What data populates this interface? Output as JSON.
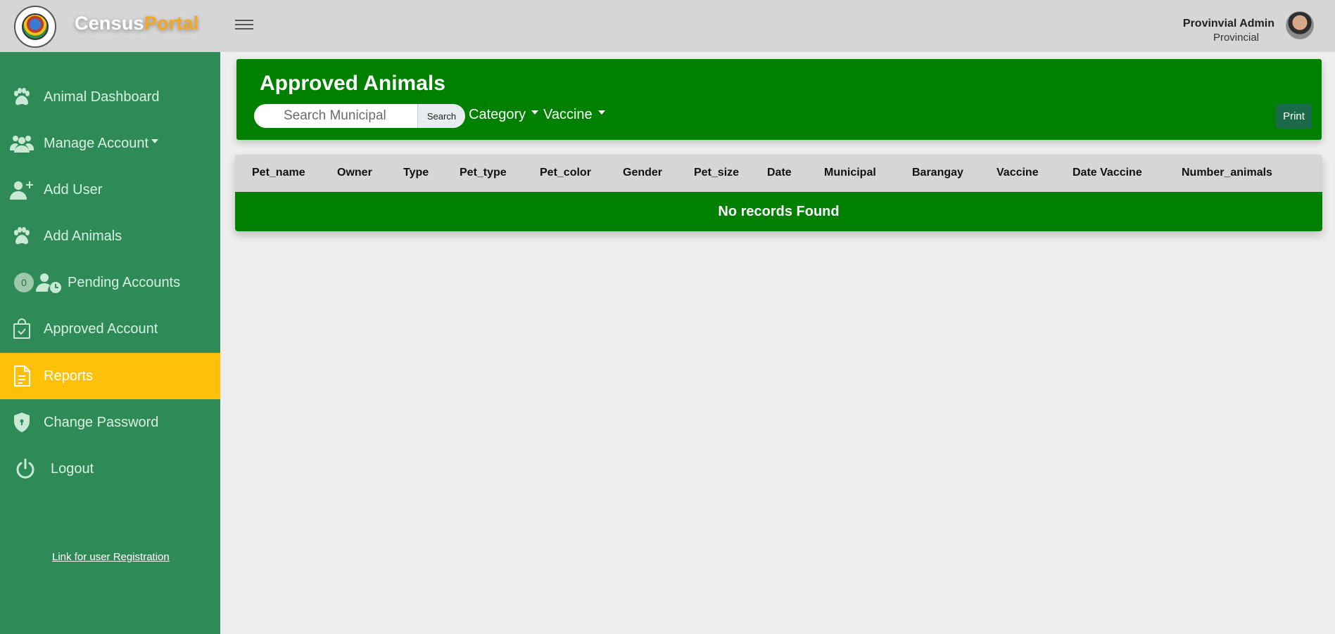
{
  "header": {
    "brand_part1": "Census",
    "brand_part2": "Portal",
    "user_name": "Provinvial Admin",
    "user_role": "Provincial"
  },
  "sidebar": {
    "items": [
      {
        "label": "Animal Dashboard",
        "icon": "paw-icon"
      },
      {
        "label": "Manage Account",
        "icon": "users-icon"
      },
      {
        "label": "Add User",
        "icon": "add-user-icon"
      },
      {
        "label": "Add Animals",
        "icon": "paw-icon"
      },
      {
        "label": "Pending Accounts",
        "icon": "user-clock-icon",
        "badge": "0"
      },
      {
        "label": "Approved Account",
        "icon": "bag-check-icon"
      },
      {
        "label": "Reports",
        "icon": "file-text-icon",
        "active": true
      },
      {
        "label": "Change Password",
        "icon": "shield-icon"
      },
      {
        "label": "Logout",
        "icon": "power-icon"
      }
    ],
    "registration_link": "Link for user Registration"
  },
  "panel": {
    "title": "Approved Animals",
    "search_placeholder": "Search Municipal",
    "search_button": "Search",
    "category_label": "Category",
    "vaccine_label": "Vaccine",
    "print_button": "Print"
  },
  "table": {
    "columns": [
      "Pet_name",
      "Owner",
      "Type",
      "Pet_type",
      "Pet_color",
      "Gender",
      "Pet_size",
      "Date",
      "Municipal",
      "Barangay",
      "Vaccine",
      "Date Vaccine",
      "Number_animals"
    ],
    "empty_message": "No records Found"
  },
  "colors": {
    "sidebar_bg": "#2e8b57",
    "active_bg": "#ffc107",
    "panel_bg": "#008000",
    "brand_accent": "#f5a623"
  }
}
